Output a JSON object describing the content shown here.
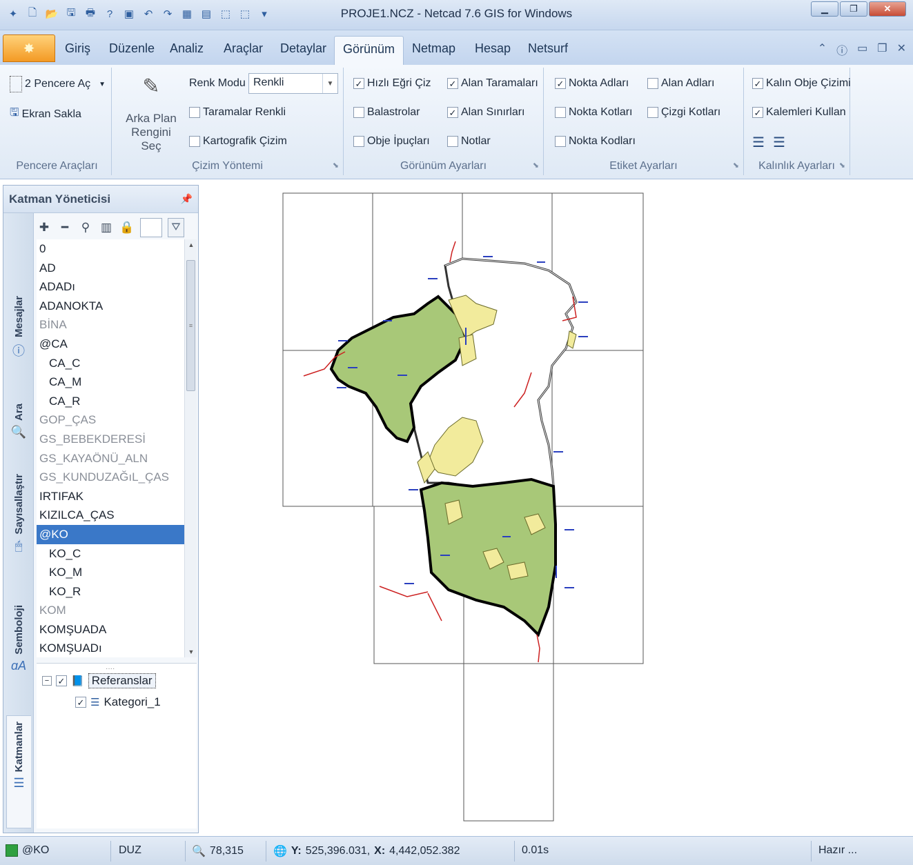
{
  "window": {
    "title": "PROJE1.NCZ - Netcad 7.6 GIS for Windows",
    "controls": [
      "minimize-icon",
      "restore-icon",
      "close-icon"
    ]
  },
  "ribbon": {
    "tabs": [
      "Giriş",
      "Düzenle",
      "Analiz",
      "Araçlar",
      "Detaylar",
      "Görünüm",
      "Netmap",
      "Hesap",
      "Netsurf"
    ],
    "active_tab": "Görünüm",
    "pencere_araclari": {
      "label": "Pencere Araçları",
      "open_windows": "2 Pencere Aç",
      "save_screen": "Ekran Sakla"
    },
    "cizim_yontemi": {
      "label": "Çizim Yöntemi",
      "background_line1": "Arka Plan",
      "background_line2": "Rengini Seç",
      "color_mode_label": "Renk Modu",
      "color_mode_value": "Renkli",
      "checks": [
        {
          "label": "Taramalar Renkli",
          "checked": false
        },
        {
          "label": "Kartografik Çizim",
          "checked": false
        }
      ]
    },
    "gorunum_ayarlari": {
      "label": "Görünüm Ayarları",
      "checks": [
        {
          "label": "Hızlı Eğri Çiz",
          "checked": true
        },
        {
          "label": "Alan Taramaları",
          "checked": true
        },
        {
          "label": "Balastrolar",
          "checked": false
        },
        {
          "label": "Alan Sınırları",
          "checked": true
        },
        {
          "label": "Obje İpuçları",
          "checked": false
        },
        {
          "label": "Notlar",
          "checked": false
        }
      ]
    },
    "etiket_ayarlari": {
      "label": "Etiket Ayarları",
      "checks": [
        {
          "label": "Nokta Adları",
          "checked": true
        },
        {
          "label": "Alan Adları",
          "checked": false
        },
        {
          "label": "Nokta Kotları",
          "checked": false
        },
        {
          "label": "Çizgi Kotları",
          "checked": false
        },
        {
          "label": "Nokta Kodları",
          "checked": false
        }
      ]
    },
    "kalinlik_ayarlari": {
      "label": "Kalınlık Ayarları",
      "checks": [
        {
          "label": "Kalın Obje Çizimi",
          "checked": true
        },
        {
          "label": "Kalemleri Kullan",
          "checked": true
        }
      ]
    }
  },
  "layer_panel": {
    "title": "Katman Yöneticisi",
    "side_tabs": [
      "Mesajlar",
      "Ara",
      "Sayısallaştır",
      "Semboloji",
      "Katmanlar"
    ],
    "layers": [
      {
        "name": "0",
        "indent": false,
        "muted": false
      },
      {
        "name": "AD",
        "indent": false,
        "muted": false
      },
      {
        "name": "ADADı",
        "indent": false,
        "muted": false
      },
      {
        "name": "ADANOKTA",
        "indent": false,
        "muted": false
      },
      {
        "name": "BİNA",
        "indent": false,
        "muted": true
      },
      {
        "name": "@CA",
        "indent": false,
        "muted": false
      },
      {
        "name": "CA_C",
        "indent": true,
        "muted": false
      },
      {
        "name": "CA_M",
        "indent": true,
        "muted": false
      },
      {
        "name": "CA_R",
        "indent": true,
        "muted": false
      },
      {
        "name": "GOP_ÇAS",
        "indent": false,
        "muted": true
      },
      {
        "name": "GS_BEBEKDERESİ",
        "indent": false,
        "muted": true
      },
      {
        "name": "GS_KAYAÖNÜ_ALN",
        "indent": false,
        "muted": true
      },
      {
        "name": "GS_KUNDUZAĞıL_ÇAS",
        "indent": false,
        "muted": true
      },
      {
        "name": "IRTIFAK",
        "indent": false,
        "muted": false
      },
      {
        "name": "KIZILCA_ÇAS",
        "indent": false,
        "muted": false
      },
      {
        "name": "@KO",
        "indent": false,
        "muted": false,
        "selected": true
      },
      {
        "name": "KO_C",
        "indent": true,
        "muted": false
      },
      {
        "name": "KO_M",
        "indent": true,
        "muted": false
      },
      {
        "name": "KO_R",
        "indent": true,
        "muted": false
      },
      {
        "name": "KOM",
        "indent": false,
        "muted": true
      },
      {
        "name": "KOMŞUADA",
        "indent": false,
        "muted": false
      },
      {
        "name": "KOMŞUADı",
        "indent": false,
        "muted": false
      }
    ],
    "references": {
      "root": "Referanslar",
      "child": "Kategori_1"
    }
  },
  "map": {
    "colors": {
      "parcel_fill": "#a8c878",
      "yellow_fill": "#f2eb9c",
      "red_lines": "#cc2020",
      "blue_marks": "#2a3fbf",
      "boundary": "#000000"
    }
  },
  "status": {
    "layer": "@KO",
    "mode": "DUZ",
    "zoom": "78,315",
    "coord_y_label": "Y:",
    "coord_y": "525,396.031,",
    "coord_x_label": "X:",
    "coord_x": "4,442,052.382",
    "time": "0.01s",
    "state": "Hazır ..."
  }
}
